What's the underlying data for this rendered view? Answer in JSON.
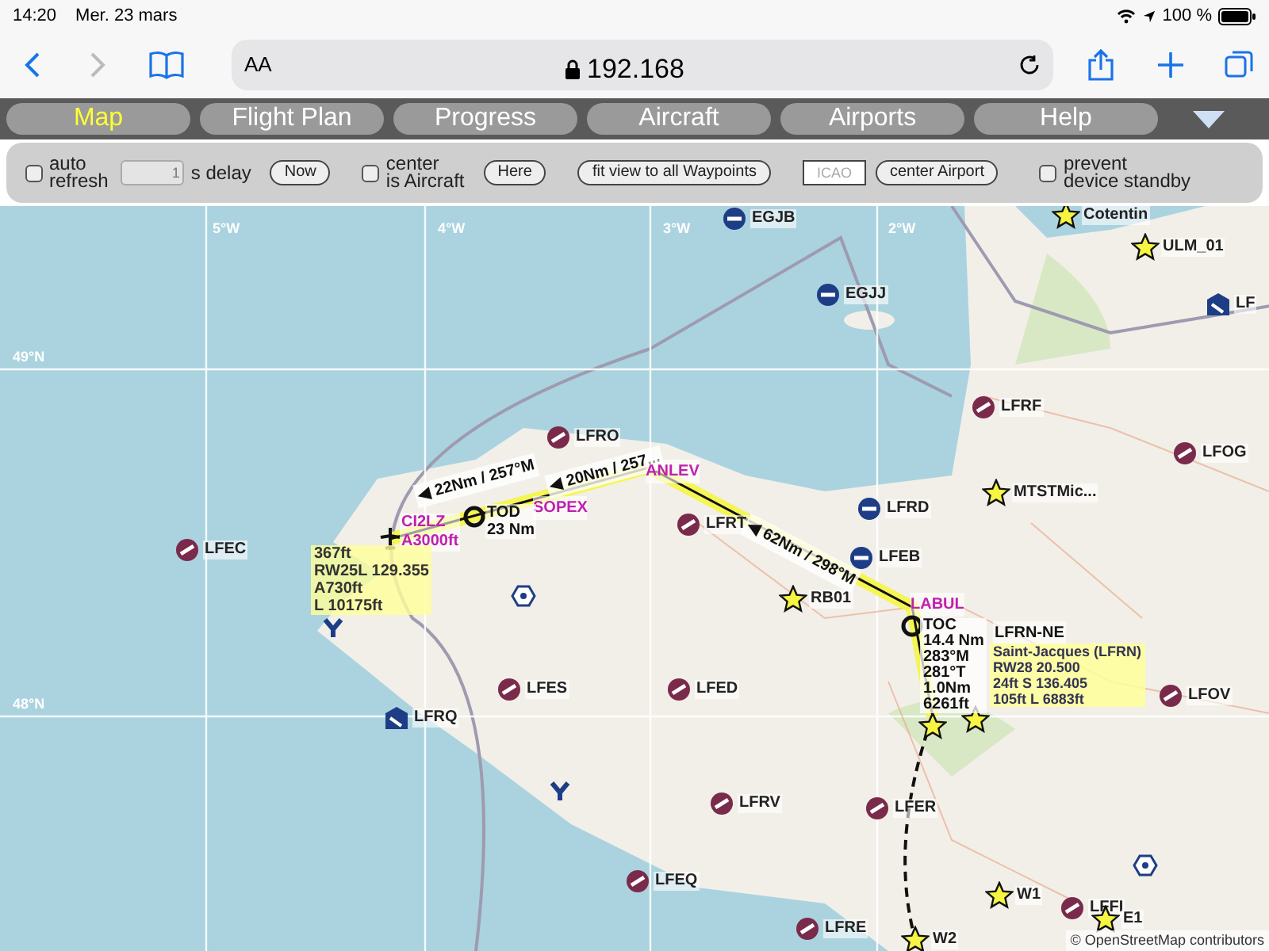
{
  "status_bar": {
    "time": "14:20",
    "date": "Mer. 23 mars",
    "battery": "100 %"
  },
  "browser": {
    "text_size": "AA",
    "url": "192.168"
  },
  "tabs": [
    {
      "label": "Map",
      "selected": true
    },
    {
      "label": "Flight Plan",
      "selected": false
    },
    {
      "label": "Progress",
      "selected": false
    },
    {
      "label": "Aircraft",
      "selected": false
    },
    {
      "label": "Airports",
      "selected": false
    },
    {
      "label": "Help",
      "selected": false
    }
  ],
  "toolbar": {
    "auto_refresh": {
      "lines": [
        "auto",
        "refresh"
      ],
      "checked": false
    },
    "delay": {
      "value": "1",
      "label": "s delay"
    },
    "now_button": "Now",
    "center_aircraft": {
      "lines": [
        "center",
        "is Aircraft"
      ],
      "checked": false
    },
    "here_button": "Here",
    "fit_button": "fit view to all Waypoints",
    "icao": {
      "placeholder": "ICAO"
    },
    "center_airport_button": "center Airport",
    "prevent_standby": {
      "lines": [
        "prevent",
        "device standby"
      ],
      "checked": false
    }
  },
  "map": {
    "graticule": [
      "5°W",
      "4°W",
      "3°W",
      "2°W",
      "49°N",
      "48°N"
    ],
    "markers": [
      {
        "kind": "airfield",
        "label": "EGJB"
      },
      {
        "kind": "airfield",
        "label": "EGJJ"
      },
      {
        "kind": "waypoint",
        "label": "Cotentin"
      },
      {
        "kind": "waypoint",
        "label": "ULM_01"
      },
      {
        "kind": "heliport",
        "label": "LF"
      },
      {
        "kind": "military",
        "label": "LFRF"
      },
      {
        "kind": "military",
        "label": "LFRO"
      },
      {
        "kind": "military",
        "label": "LFOG"
      },
      {
        "kind": "airfield",
        "label": "LFRD"
      },
      {
        "kind": "waypoint",
        "label": "MTSTMic..."
      },
      {
        "kind": "military",
        "label": "LFRT"
      },
      {
        "kind": "airfield",
        "label": "LFEB"
      },
      {
        "kind": "military",
        "label": "LFEC"
      },
      {
        "kind": "waypoint",
        "label": "RB01"
      },
      {
        "kind": "military",
        "label": "LFES"
      },
      {
        "kind": "military",
        "label": "LFED"
      },
      {
        "kind": "military",
        "label": "LFOV"
      },
      {
        "kind": "heliport",
        "label": "LFRQ"
      },
      {
        "kind": "military",
        "label": "LFRV"
      },
      {
        "kind": "military",
        "label": "LFER"
      },
      {
        "kind": "military",
        "label": "LFEQ"
      },
      {
        "kind": "military",
        "label": "LFRE"
      },
      {
        "kind": "waypoint",
        "label": "W1"
      },
      {
        "kind": "military",
        "label": "LFFI"
      },
      {
        "kind": "waypoint",
        "label": "E1"
      },
      {
        "kind": "waypoint",
        "label": "W2"
      },
      {
        "kind": "waypoint"
      },
      {
        "kind": "waypoint"
      },
      {
        "kind": "vor"
      },
      {
        "kind": "vor"
      },
      {
        "kind": "ndb"
      },
      {
        "kind": "ndb"
      }
    ],
    "route": {
      "legs": [
        "◀ 22Nm / 257°M",
        "◀ 20Nm / 257...",
        "◀ 62Nm / 298°M"
      ],
      "waypoints": [
        {
          "label": "SOPEX"
        },
        {
          "label": "ANLEV"
        },
        {
          "label": "LABUL"
        }
      ],
      "tod": {
        "label": "TOD",
        "distance": "23 Nm"
      },
      "toc": [
        "TOC",
        "14.4 Nm",
        "283°M",
        "281°T",
        "1.0Nm",
        "6261ft"
      ],
      "departure_tags": [
        "CI2LZ",
        "A3000ft"
      ],
      "departure_info": [
        "367ft",
        "RW25L 129.355",
        "A730ft",
        "L 10175ft"
      ],
      "arrival_point": "LFRN-NE",
      "arrival_info": [
        "Saint-Jacques (LFRN)",
        "RW28 20.500",
        "24ft S 136.405",
        "105ft L 6883ft"
      ]
    },
    "attribution": "© OpenStreetMap contributors"
  }
}
